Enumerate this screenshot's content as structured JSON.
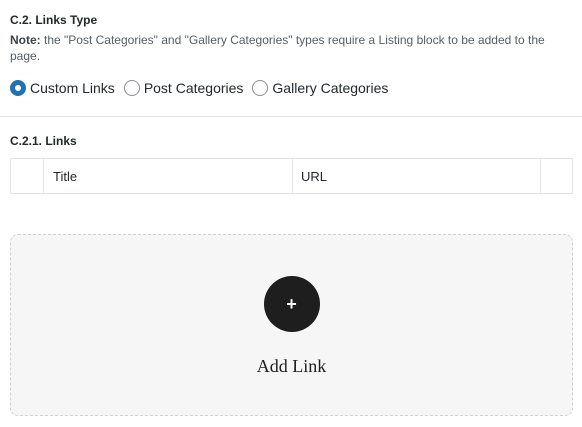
{
  "links_type": {
    "heading": "C.2. Links Type",
    "note_bold": "Note:",
    "note_text": " the \"Post Categories\" and \"Gallery Categories\" types require a Listing block to be added to the page.",
    "options": [
      {
        "label": "Custom Links",
        "checked": true
      },
      {
        "label": "Post Categories",
        "checked": false
      },
      {
        "label": "Gallery Categories",
        "checked": false
      }
    ]
  },
  "links": {
    "heading": "C.2.1. Links",
    "columns": [
      "Title",
      "URL"
    ],
    "add_icon": "plus-icon",
    "add_symbol": "+",
    "add_label": "Add Link"
  },
  "colors": {
    "accent": "#2271b1",
    "button_bg": "#1e1e1e",
    "dropzone_bg": "#f6f6f6"
  }
}
